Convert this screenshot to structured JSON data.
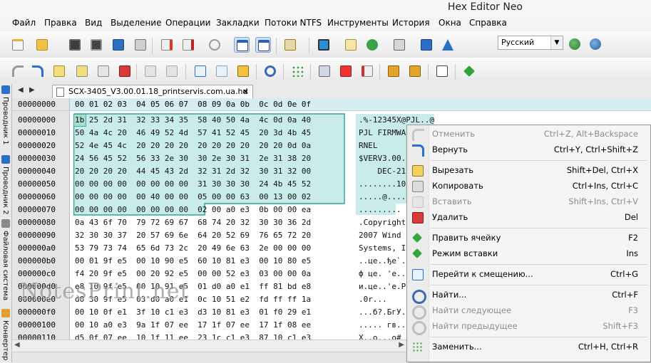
{
  "window": {
    "title": "Hex Editor Neo"
  },
  "menu": [
    "Файл",
    "Правка",
    "Вид",
    "Выделение",
    "Операции",
    "Закладки",
    "Потоки NTFS",
    "Инструменты",
    "История",
    "Окна",
    "Справка"
  ],
  "toolbar": {
    "language": "Русский"
  },
  "side_tabs": [
    "Проводник 1",
    "Проводник 2",
    "Файловая система",
    "Конвертер"
  ],
  "document_tab": {
    "label": "SCX-3405_V3.00.01.18_printservis.com.ua.hd"
  },
  "hex": {
    "header_offset": "00000000",
    "columns": "00 01 02 03  04 05 06 07  08 09 0a 0b  0c 0d 0e 0f",
    "rows": [
      {
        "offset": "00000000",
        "bytes": "1b 25 2d 31  32 33 34 35  58 40 50 4a  4c 0d 0a 40",
        "text": ".%-12345X@PJL..@"
      },
      {
        "offset": "00000010",
        "bytes": "50 4a 4c 20  46 49 52 4d  57 41 52 45  20 3d 4b 45",
        "text": "PJL FIRMWA"
      },
      {
        "offset": "00000020",
        "bytes": "52 4e 45 4c  20 20 20 20  20 20 20 20  20 20 0d 0a",
        "text": "RNEL"
      },
      {
        "offset": "00000030",
        "bytes": "24 56 45 52  56 33 2e 30  30 2e 30 31  2e 31 38 20",
        "text": "$VERV3.00."
      },
      {
        "offset": "00000040",
        "bytes": "20 20 20 20  44 45 43 2d  32 31 2d 32  30 31 32 00",
        "text": "    DEC-21"
      },
      {
        "offset": "00000050",
        "bytes": "00 00 00 00  00 00 00 00  31 30 30 30  24 4b 45 52",
        "text": "........10"
      },
      {
        "offset": "00000060",
        "bytes": "00 00 00 00  00 40 00 00  05 00 00 63  00 13 00 02",
        "text": ".....@...."
      },
      {
        "offset": "00000070",
        "bytes": "00 00 00 00  00 00 00 00  02 00 a0 e3  0b 00 00 ea",
        "text": "........."
      },
      {
        "offset": "00000080",
        "bytes": "0a 43 6f 70  79 72 69 67  68 74 20 32  30 30 36 2d",
        "text": ".Copyright"
      },
      {
        "offset": "00000090",
        "bytes": "32 30 30 37  20 57 69 6e  64 20 52 69  76 65 72 20",
        "text": "2007 Wind"
      },
      {
        "offset": "000000a0",
        "bytes": "53 79 73 74  65 6d 73 2c  20 49 6e 63  2e 00 00 00",
        "text": "Systems, I"
      },
      {
        "offset": "000000b0",
        "bytes": "00 01 9f e5  00 10 90 e5  60 10 81 e3  00 10 80 e5",
        "text": "..це..ђе`."
      },
      {
        "offset": "000000c0",
        "bytes": "f4 20 9f e5  00 20 92 e5  00 00 52 e3  03 00 00 0a",
        "text": "ф це. 'е.."
      },
      {
        "offset": "000000d0",
        "bytes": "e8 10 9f e5  00 10 91 e5  01 d0 a0 e1  ff 81 bd e8",
        "text": "и.це..'е.Р"
      },
      {
        "offset": "000000e0",
        "bytes": "d0 30 9f e5  03 d0 a0 e1  0c 10 51 e2  fd ff ff 1a",
        "text": ".0r..."
      },
      {
        "offset": "000000f0",
        "bytes": "00 10 0f e1  3f 10 c1 e3  d3 10 81 e3  01 f0 29 e1",
        "text": "...б?.БгУ."
      },
      {
        "offset": "00000100",
        "bytes": "00 10 a0 e3  9a 1f 07 ee  17 1f 07 ee  17 1f 08 ee",
        "text": "..... гв..о"
      },
      {
        "offset": "00000110",
        "bytes": "d5 0f 07 ee  10 1f 11 ee  23 1c c1 e3  87 10 c1 e3",
        "text": "Х..о...о#"
      }
    ]
  },
  "watermark": "NotesPrint.net",
  "context_menu": [
    {
      "label": "Отменить",
      "shortcut": "Ctrl+Z, Alt+Backspace",
      "disabled": true,
      "icon": "undo-icon"
    },
    {
      "label": "Вернуть",
      "shortcut": "Ctrl+Y, Ctrl+Shift+Z",
      "disabled": false,
      "icon": "redo-icon"
    },
    {
      "label": "Вырезать",
      "shortcut": "Shift+Del, Ctrl+X",
      "disabled": false,
      "icon": "cut-icon"
    },
    {
      "label": "Копировать",
      "shortcut": "Ctrl+Ins, Ctrl+C",
      "disabled": false,
      "icon": "copy-icon"
    },
    {
      "label": "Вставить",
      "shortcut": "Shift+Ins, Ctrl+V",
      "disabled": true,
      "icon": "paste-icon"
    },
    {
      "label": "Удалить",
      "shortcut": "Del",
      "disabled": false,
      "icon": "delete-icon"
    },
    {
      "label": "Править ячейку",
      "shortcut": "F2",
      "disabled": false,
      "icon": "edit-cell-icon"
    },
    {
      "label": "Режим вставки",
      "shortcut": "Ins",
      "disabled": false,
      "icon": "insert-mode-icon"
    },
    {
      "label": "Перейти к смещению...",
      "shortcut": "Ctrl+G",
      "disabled": false,
      "icon": "goto-offset-icon"
    },
    {
      "label": "Найти...",
      "shortcut": "Ctrl+F",
      "disabled": false,
      "icon": "find-icon"
    },
    {
      "label": "Найти следующее",
      "shortcut": "F3",
      "disabled": true,
      "icon": "find-next-icon"
    },
    {
      "label": "Найти предыдущее",
      "shortcut": "Shift+F3",
      "disabled": true,
      "icon": "find-prev-icon"
    },
    {
      "label": "Заменить...",
      "shortcut": "Ctrl+H, Ctrl+R",
      "disabled": false,
      "icon": "replace-icon"
    }
  ],
  "colors": {
    "selection": "#c9ecea",
    "header": "#d6eef0",
    "offset_bg": "#e4e4e4",
    "disabled_text": "#8c8c8c"
  }
}
